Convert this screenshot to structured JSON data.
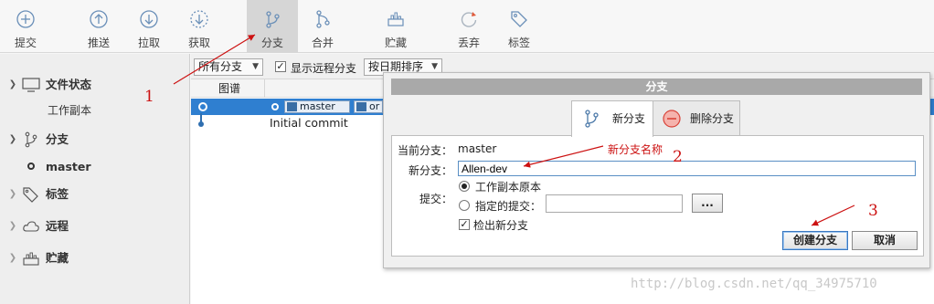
{
  "toolbar": {
    "buttons": [
      {
        "label": "提交",
        "icon": "plus-circle-icon"
      },
      {
        "label": "推送",
        "icon": "arrow-up-circle-icon"
      },
      {
        "label": "拉取",
        "icon": "arrow-down-circle-icon"
      },
      {
        "label": "获取",
        "icon": "dashed-arrow-down-circle-icon"
      },
      {
        "label": "分支",
        "icon": "branch-icon",
        "active": true
      },
      {
        "label": "合并",
        "icon": "merge-icon"
      },
      {
        "label": "贮藏",
        "icon": "stash-icon"
      },
      {
        "label": "丢弃",
        "icon": "discard-icon"
      },
      {
        "label": "标签",
        "icon": "tag-icon"
      }
    ]
  },
  "sidebar": {
    "workspace": {
      "label": "文件状态",
      "icon": "monitor-icon",
      "child": "工作副本"
    },
    "branches": {
      "label": "分支",
      "icon": "branch-icon",
      "child": "master"
    },
    "tags": {
      "label": "标签",
      "icon": "tag-icon"
    },
    "remotes": {
      "label": "远程",
      "icon": "cloud-icon"
    },
    "stashes": {
      "label": "贮藏",
      "icon": "stash-icon"
    }
  },
  "filterbar": {
    "branch_filter": "所有分支",
    "show_remote_label": "显示远程分支",
    "show_remote_checked": true,
    "sort": "按日期排序"
  },
  "history": {
    "graph_header": "图谱",
    "commits": [
      {
        "tags": [
          "master",
          "or"
        ],
        "selected": true
      },
      {
        "message": "Initial commit"
      }
    ]
  },
  "dialog": {
    "title": "分支",
    "tabs": [
      {
        "label": "新分支",
        "icon": "branch-icon",
        "selected": true
      },
      {
        "label": "删除分支",
        "icon": "minus-circle-icon"
      }
    ],
    "current_branch_label": "当前分支：",
    "current_branch_value": "master",
    "new_branch_label": "新分支：",
    "new_branch_value": "Allen-dev",
    "commit_label": "提交：",
    "option_working_copy": "工作副本原本",
    "option_specified": "指定的提交：",
    "browse_label": "...",
    "checkout_label": "检出新分支",
    "checkout_checked": true,
    "create_button": "创建分支",
    "cancel_button": "取消"
  },
  "annotations": {
    "step1": "1",
    "step2": "2",
    "step3": "3",
    "note_new_branch": "新分支名称",
    "annotation_color": "#cc1111"
  },
  "watermark": "http://blog.csdn.net/qq_34975710",
  "colors": {
    "selection": "#2f7fd0",
    "toolbar_active": "#d6d6d6",
    "dialog_title_bar": "#a9a9a9"
  }
}
